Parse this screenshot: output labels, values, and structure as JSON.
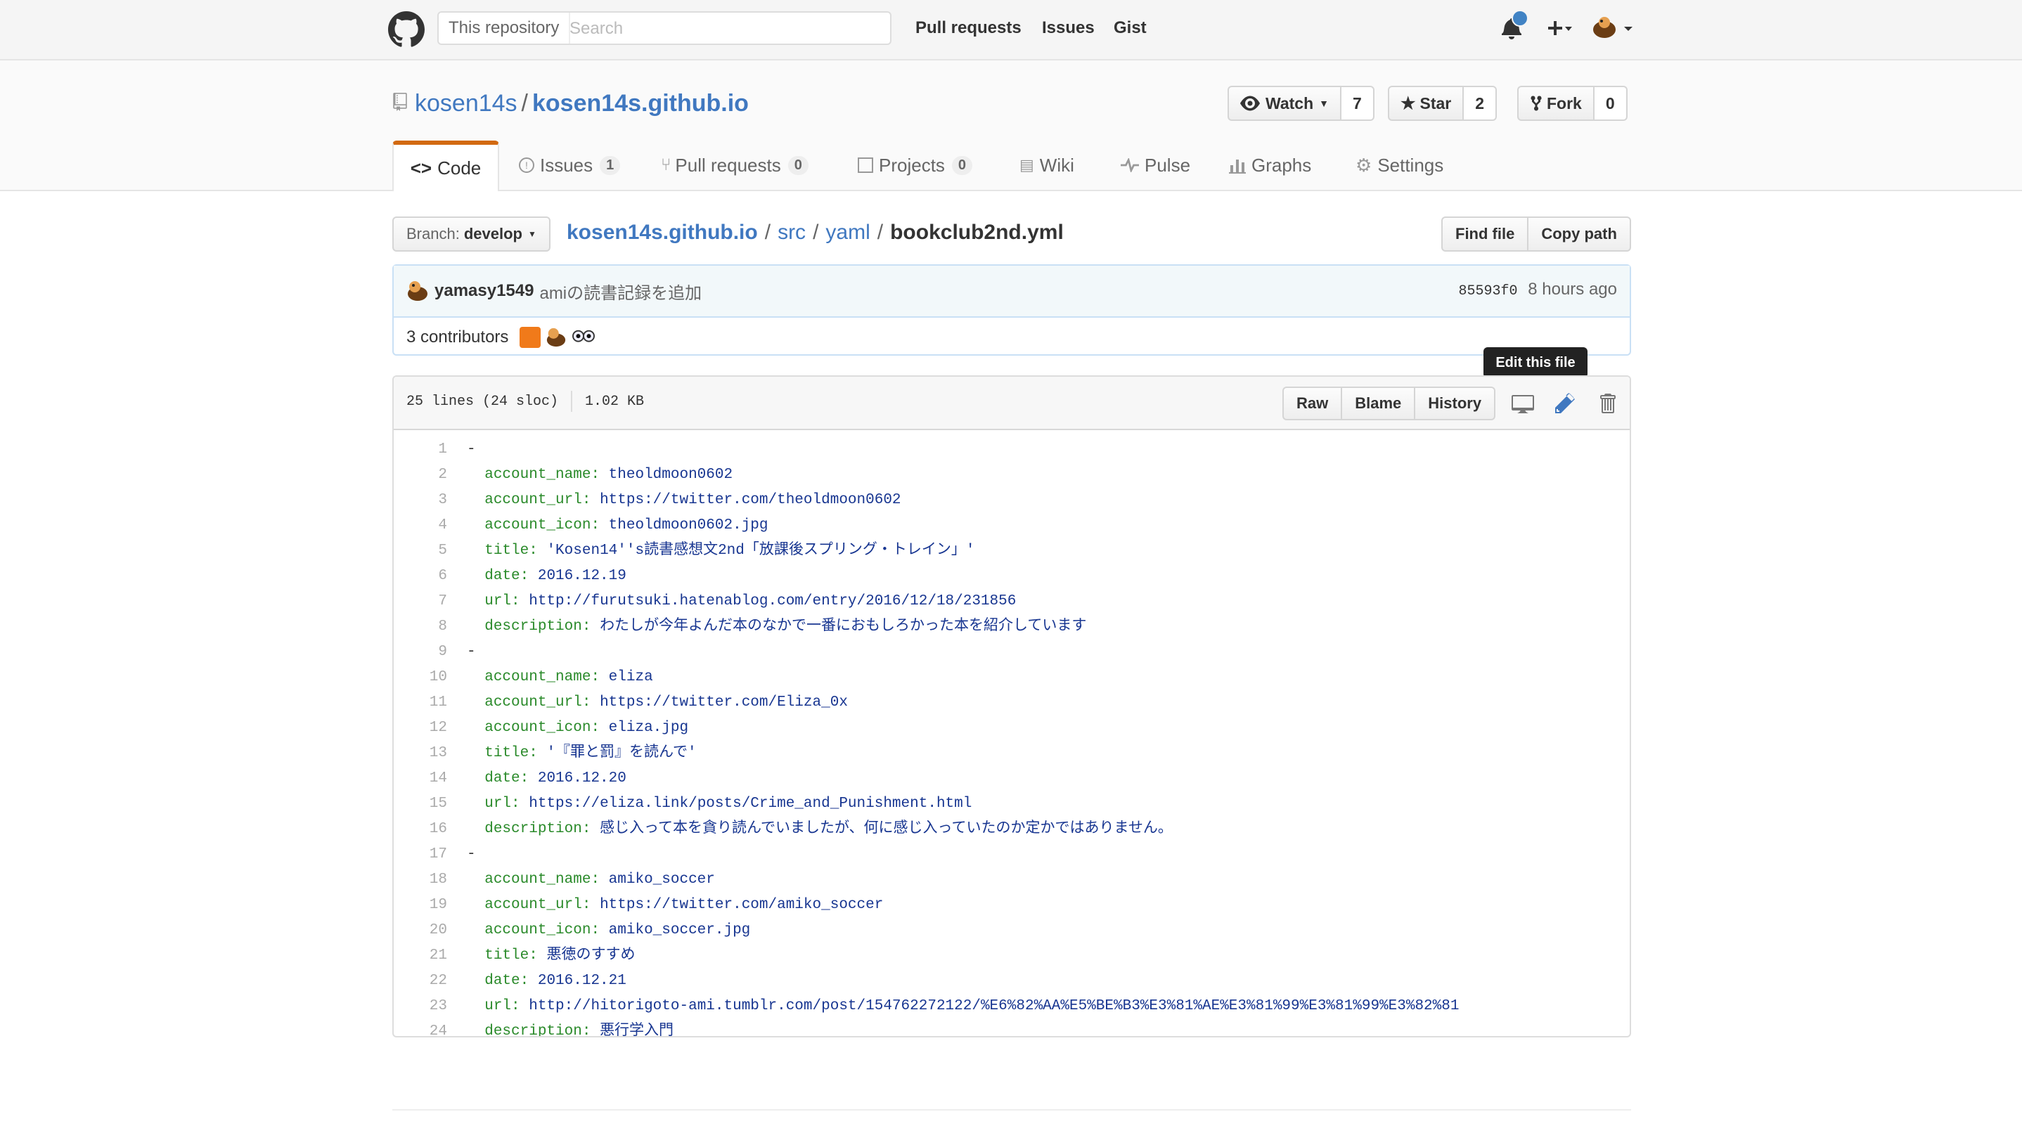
{
  "nav": {
    "scope_label": "This repository",
    "search_placeholder": "Search",
    "links": [
      "Pull requests",
      "Issues",
      "Gist"
    ]
  },
  "repo": {
    "owner": "kosen14s",
    "name": "kosen14s.github.io",
    "watch_label": "Watch",
    "watch_count": "7",
    "star_label": "Star",
    "star_count": "2",
    "fork_label": "Fork",
    "fork_count": "0"
  },
  "tabs": [
    {
      "label": "Code"
    },
    {
      "label": "Issues",
      "count": "1"
    },
    {
      "label": "Pull requests",
      "count": "0"
    },
    {
      "label": "Projects",
      "count": "0"
    },
    {
      "label": "Wiki"
    },
    {
      "label": "Pulse"
    },
    {
      "label": "Graphs"
    },
    {
      "label": "Settings"
    }
  ],
  "branch": {
    "prefix": "Branch:",
    "name": "develop"
  },
  "breadcrumb": {
    "root": "kosen14s.github.io",
    "dir1": "src",
    "dir2": "yaml",
    "file": "bookclub2nd.yml"
  },
  "find_buttons": {
    "find": "Find file",
    "copy": "Copy path"
  },
  "commit": {
    "author": "yamasy1549",
    "message": "amiの読書記録を追加",
    "sha": "85593f0",
    "time": "8 hours ago",
    "contributors": "3 contributors"
  },
  "file": {
    "lines_info": "25 lines (24 sloc)",
    "size": "1.02 KB",
    "raw": "Raw",
    "blame": "Blame",
    "history": "History",
    "tooltip": "Edit this file"
  },
  "code_lines": [
    {
      "n": "1",
      "key": "",
      "val": "-",
      "dash": true
    },
    {
      "n": "2",
      "key": "account_name:",
      "val": "theoldmoon0602"
    },
    {
      "n": "3",
      "key": "account_url:",
      "val": "https://twitter.com/theoldmoon0602"
    },
    {
      "n": "4",
      "key": "account_icon:",
      "val": "theoldmoon0602.jpg"
    },
    {
      "n": "5",
      "key": "title:",
      "val": "'Kosen14''s読書感想文2nd「放課後スプリング・トレイン」'"
    },
    {
      "n": "6",
      "key": "date:",
      "val": "2016.12.19"
    },
    {
      "n": "7",
      "key": "url:",
      "val": "http://furutsuki.hatenablog.com/entry/2016/12/18/231856"
    },
    {
      "n": "8",
      "key": "description:",
      "val": "わたしが今年よんだ本のなかで一番におもしろかった本を紹介しています"
    },
    {
      "n": "9",
      "key": "",
      "val": "-",
      "dash": true
    },
    {
      "n": "10",
      "key": "account_name:",
      "val": "eliza"
    },
    {
      "n": "11",
      "key": "account_url:",
      "val": "https://twitter.com/Eliza_0x"
    },
    {
      "n": "12",
      "key": "account_icon:",
      "val": "eliza.jpg"
    },
    {
      "n": "13",
      "key": "title:",
      "val": "'『罪と罰』を読んで'"
    },
    {
      "n": "14",
      "key": "date:",
      "val": "2016.12.20"
    },
    {
      "n": "15",
      "key": "url:",
      "val": "https://eliza.link/posts/Crime_and_Punishment.html"
    },
    {
      "n": "16",
      "key": "description:",
      "val": "感じ入って本を貪り読んでいましたが、何に感じ入っていたのか定かではありません。"
    },
    {
      "n": "17",
      "key": "",
      "val": "-",
      "dash": true
    },
    {
      "n": "18",
      "key": "account_name:",
      "val": "amiko_soccer"
    },
    {
      "n": "19",
      "key": "account_url:",
      "val": "https://twitter.com/amiko_soccer"
    },
    {
      "n": "20",
      "key": "account_icon:",
      "val": "amiko_soccer.jpg"
    },
    {
      "n": "21",
      "key": "title:",
      "val": "悪徳のすすめ"
    },
    {
      "n": "22",
      "key": "date:",
      "val": "2016.12.21"
    },
    {
      "n": "23",
      "key": "url:",
      "val": "http://hitorigoto-ami.tumblr.com/post/154762272122/%E6%82%AA%E5%BE%B3%E3%81%AE%E3%81%99%E3%81%99%E3%82%81"
    },
    {
      "n": "24",
      "key": "description:",
      "val": "悪行学入門"
    }
  ],
  "colors": {
    "link": "#4078c0",
    "key": "#2a8a2a",
    "value": "#183691",
    "tab_accent": "#d26911",
    "notification": "#4183c4"
  }
}
